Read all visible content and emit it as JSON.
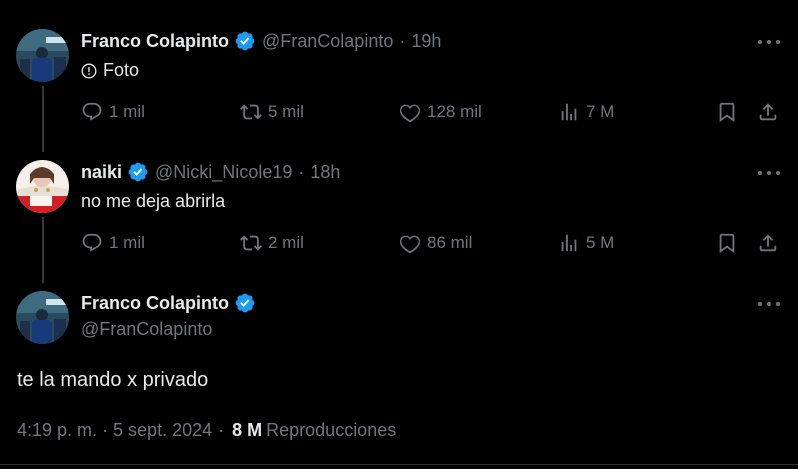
{
  "colors": {
    "background": "#000000",
    "text": "#e7e9ea",
    "muted": "#71767b",
    "verified": "#1d9bf0"
  },
  "tweets": [
    {
      "author_name": "Franco Colapinto",
      "handle": "@FranColapinto",
      "separator": "·",
      "time": "19h",
      "text": "Foto",
      "text_icon": "info-circle-icon",
      "stats": {
        "replies": "1 mil",
        "retweets": "5 mil",
        "likes": "128 mil",
        "views": "7 M"
      }
    },
    {
      "author_name": "naiki",
      "handle": "@Nicki_Nicole19",
      "separator": "·",
      "time": "18h",
      "text": "no me deja abrirla",
      "stats": {
        "replies": "1 mil",
        "retweets": "2 mil",
        "likes": "86 mil",
        "views": "5 M"
      }
    }
  ],
  "main_tweet": {
    "author_name": "Franco Colapinto",
    "handle": "@FranColapinto",
    "text": "te la mando x privado",
    "timestamp": "4:19 p. m. · 5 sept. 2024",
    "separator": "·",
    "views": "8 M",
    "views_label": "Reproducciones"
  }
}
